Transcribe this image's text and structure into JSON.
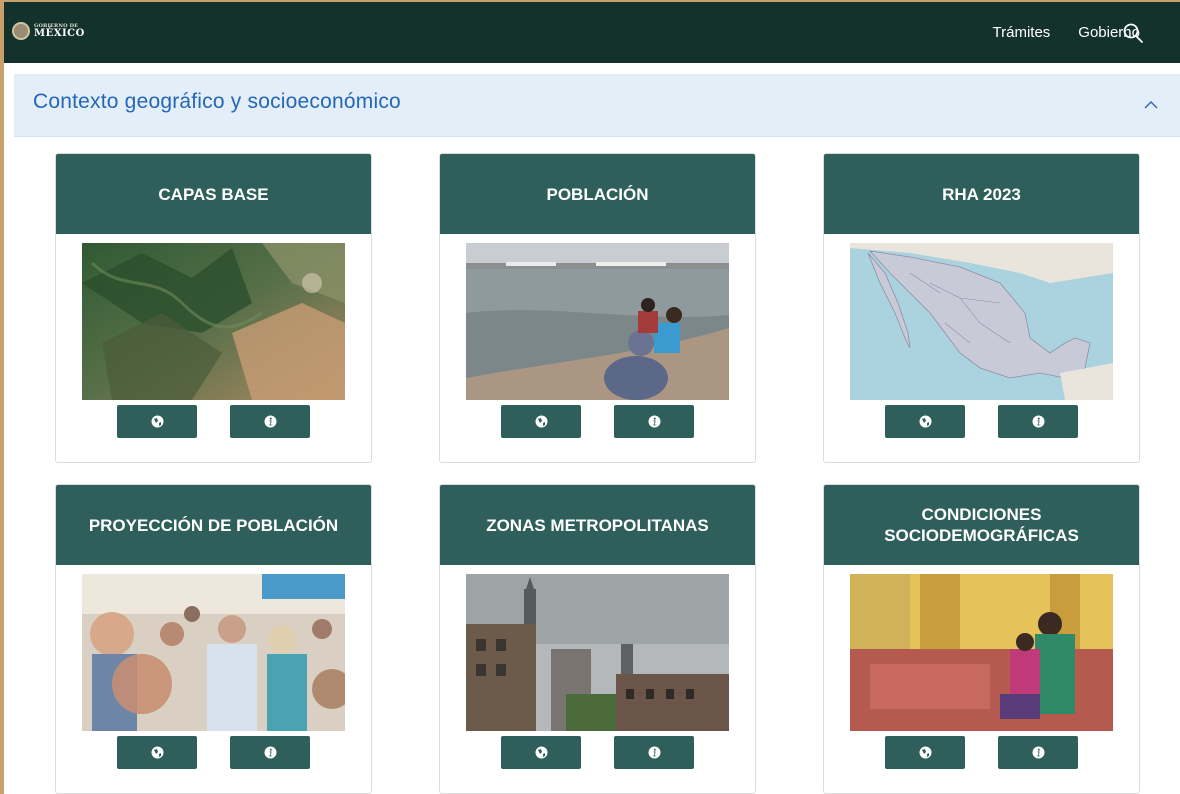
{
  "navbar": {
    "logo_small": "GOBIERNO DE",
    "logo_big": "MÉXICO",
    "links": [
      "Trámites",
      "Gobierno"
    ],
    "search_icon": "search-icon",
    "background": "#13322b"
  },
  "section": {
    "title": "Contexto geográfico y socioeconómico",
    "toggle_icon": "chevron-up-icon",
    "accent": "#2467b8"
  },
  "cards": [
    {
      "title": "CAPAS BASE",
      "image": "satellite-terrain-image",
      "map_icon": "globe-icon",
      "info_icon": "info-icon"
    },
    {
      "title": "POBLACIÓN",
      "image": "children-by-lake-image",
      "map_icon": "globe-icon",
      "info_icon": "info-icon"
    },
    {
      "title": "RHA 2023",
      "image": "mexico-map-image",
      "map_icon": "globe-icon",
      "info_icon": "info-icon"
    },
    {
      "title": "PROYECCIÓN DE POBLACIÓN",
      "image": "crowd-image",
      "map_icon": "globe-icon",
      "info_icon": "info-icon"
    },
    {
      "title": "ZONAS METROPOLITANAS",
      "image": "city-skyline-image",
      "map_icon": "globe-icon",
      "info_icon": "info-icon"
    },
    {
      "title": "CONDICIONES SOCIODEMOGRÁFICAS",
      "image": "market-women-image",
      "map_icon": "globe-icon",
      "info_icon": "info-icon"
    }
  ],
  "colors": {
    "card_header": "#2f5f5a",
    "frame": "#c8a06a"
  }
}
